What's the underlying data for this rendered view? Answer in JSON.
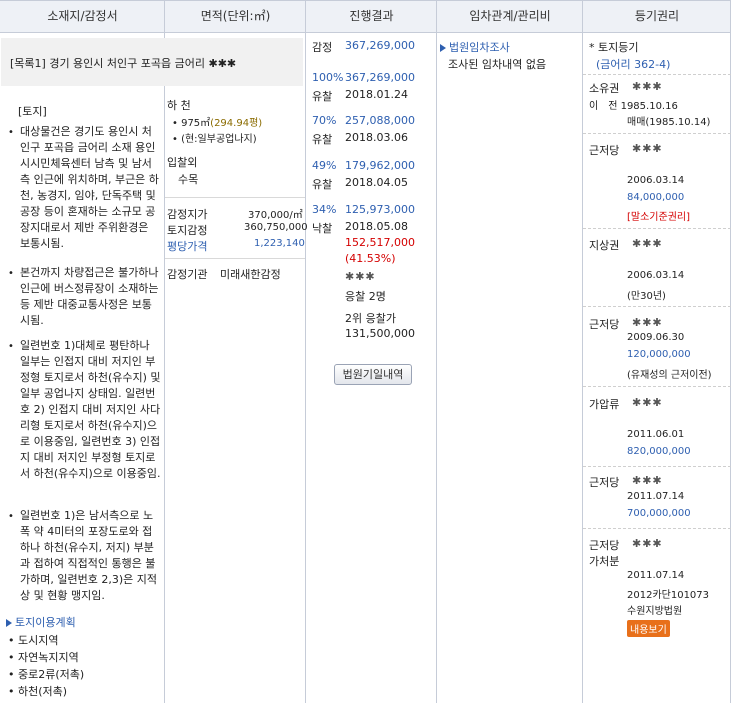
{
  "headers": {
    "location": "소재지/감정서",
    "area": "면적(단위:㎡)",
    "progress": "진행결과",
    "lease": "임차관계/관리비",
    "registry": "등기권리"
  },
  "property": {
    "title": "[목록1] 경기 용인시 처인구 포곡읍 금어리 ✱✱✱",
    "section": "[토지]"
  },
  "descriptions": [
    "대상물건은 경기도 용인시 처인구 포곡읍 금어리 소재 용인시시민체육센터 남측 및 남서측 인근에 위치하며, 부근은 하천, 농경지, 임야, 단독주택 및 공장 등이 혼재하는 소규모 공장지대로서 제반 주위환경은 보통시됨.",
    "본건까지 차량접근은 불가하나 인근에 버스정류장이 소재하는 등 제반 대중교통사정은 보통시됨.",
    "일련번호 1)대체로 평탄하나 일부는 인접지 대비 저지인 부정형 토지로서 하천(유수지) 및 일부 공업나지 상태임. 일련번호 2) 인접지 대비 저지인 사다리형 토지로서 하천(유수지)으로 이용중임, 일련번호 3) 인접지 대비 저지인 부정형 토지로서 하천(유수지)으로 이용중임.",
    "일련번호 1)은 남서측으로 노폭 약 4미터의 포장도로와 접하나 하천(유수지, 저지) 부분과 접하여 직접적인 통행은 불가하며, 일련번호 2,3)은 지적상 및 현황 맹지임."
  ],
  "land_use": {
    "label": "토지이용계획",
    "items": [
      "도시지역",
      "자연녹지지역",
      "중로2류(저촉)",
      "하천(저촉)"
    ]
  },
  "area": {
    "type": "하 천",
    "size": "975㎡",
    "pyeong": "(294.94평)",
    "current": "(현:일부공업나지)",
    "bid_label": "입찰외",
    "bid_item": "수목",
    "appraisal_unit_label": "감정지가",
    "appraisal_unit_value": "370,000/㎡",
    "land_appraisal_label": "토지감정",
    "land_appraisal_value": "360,750,000",
    "avg_price_label": "평당가격",
    "avg_price_value": "1,223,140",
    "agency_label": "감정기관",
    "agency_value": "미래새한감정"
  },
  "progress": {
    "appraisal_label": "감정",
    "appraisal_value": "367,269,000",
    "rounds": [
      {
        "pct": "100%",
        "price": "367,269,000",
        "status": "유찰",
        "date": "2018.01.24"
      },
      {
        "pct": "70%",
        "price": "257,088,000",
        "status": "유찰",
        "date": "2018.03.06"
      },
      {
        "pct": "49%",
        "price": "179,962,000",
        "status": "유찰",
        "date": "2018.04.05"
      },
      {
        "pct": "34%",
        "price": "125,973,000",
        "status": "낙찰",
        "date": "2018.05.08"
      }
    ],
    "winning_price": "152,517,000",
    "winning_ratio": "(41.53%)",
    "winner": "✱✱✱",
    "bidders": "응찰 2명",
    "second_label": "2위 응찰가",
    "second_price": "131,500,000",
    "court_button": "법원기일내역"
  },
  "lease": {
    "title": "법원임차조사",
    "note": "조사된 임차내역 없음"
  },
  "registry": {
    "land_label": "* 토지등기",
    "land_sub": "(금어리 362-4)",
    "entries": [
      {
        "type": "소유권",
        "who": "✱✱✱",
        "l1": "이　전 1985.10.16",
        "l2": "매매(1985.10.14)"
      },
      {
        "type": "근저당",
        "who": "✱✱✱",
        "l1": "2006.03.14",
        "l2": "84,000,000",
        "l3": "[말소기준권리]"
      },
      {
        "type": "지상권",
        "who": "✱✱✱",
        "l1": "2006.03.14",
        "l2": "(만30년)"
      },
      {
        "type": "근저당",
        "who": "✱✱✱",
        "l1": "2009.06.30",
        "l2": "120,000,000",
        "l3": "(유재성의 근저이전)"
      },
      {
        "type": "가압류",
        "who": "✱✱✱",
        "l1": "2011.06.01",
        "l2": "820,000,000"
      },
      {
        "type": "근저당",
        "who": "✱✱✱",
        "l1": "2011.07.14",
        "l2": "700,000,000"
      },
      {
        "type": "근저당",
        "type2": "가처분",
        "who": "✱✱✱",
        "l1": "2011.07.14",
        "l2": "2012카단101073",
        "l3": "수원지방법원",
        "badge": "내용보기"
      }
    ]
  }
}
